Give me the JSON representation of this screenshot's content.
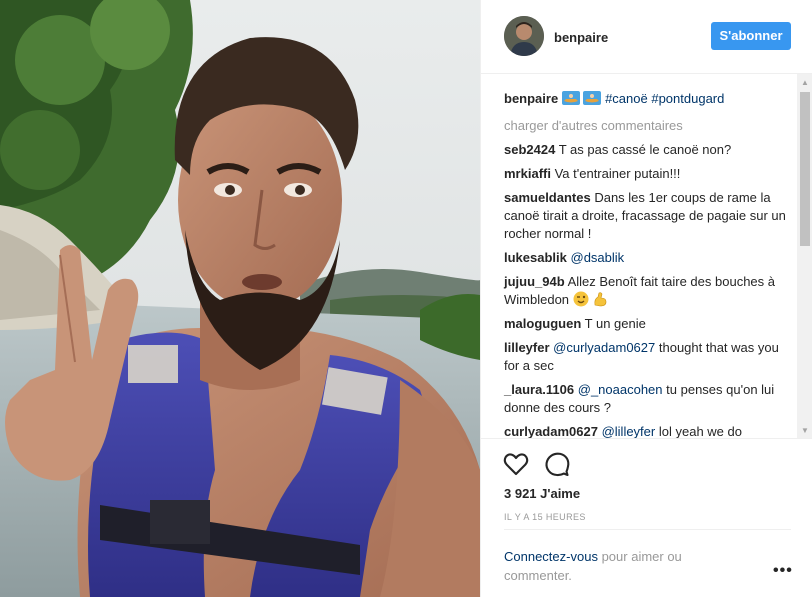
{
  "post": {
    "username": "benpaire",
    "follow_label": "S'abonner",
    "caption": {
      "username": "benpaire",
      "icons": [
        "canoe-emoji",
        "canoe-emoji"
      ],
      "hashtags": [
        "#canoë",
        "#pontdugard"
      ]
    },
    "load_more_label": "charger d'autres commentaires",
    "comments": [
      {
        "user": "seb2424",
        "text": "T as pas cassé le canoë non?"
      },
      {
        "user": "mrkiaffi",
        "text": "Va t'entrainer putain!!!"
      },
      {
        "user": "samueldantes",
        "text": "Dans les 1er coups de rame la canoë tirait a droite, fracassage de pagaie sur un rocher normal !"
      },
      {
        "user": "lukesablik",
        "mention": "@dsablik",
        "text": ""
      },
      {
        "user": "jujuu_94b",
        "text": "Allez Benoît fait taire des bouches à Wimbledon",
        "icons": [
          "wink-emoji",
          "flexed-biceps-emoji"
        ]
      },
      {
        "user": "maloguguen",
        "text": "T un genie"
      },
      {
        "user": "lilleyfer",
        "mention": "@curlyadam0627",
        "text": "thought that was you for a sec"
      },
      {
        "user": "_laura.1106",
        "mention": "@_noaacohen",
        "text": "tu penses qu'on lui donne des cours ?"
      },
      {
        "user": "curlyadam0627",
        "mention": "@lilleyfer",
        "text": "lol yeah we do"
      }
    ],
    "likes_label": "3 921 J'aime",
    "time_label": "IL Y A 15 HEURES",
    "login_link_label": "Connectez-vous",
    "login_rest_label": "pour aimer ou commenter.",
    "more_label": "•••",
    "icons": {
      "like": "heart-outline-icon",
      "comment": "speech-bubble-icon",
      "more": "ellipsis-icon"
    },
    "colors": {
      "follow_button": "#3897f0",
      "link": "#003569",
      "muted": "#999999"
    }
  }
}
